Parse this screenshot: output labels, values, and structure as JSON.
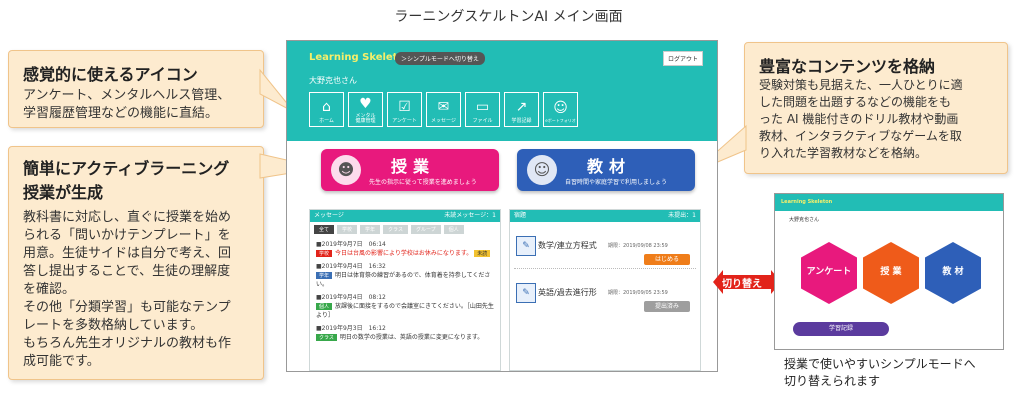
{
  "caption_top": "ラーニングスケルトンAI メイン画面",
  "callouts": {
    "icons": {
      "title": "感覚的に使えるアイコン",
      "body": "アンケート、メンタルヘルス管理、\n学習履歴管理などの機能に直結。"
    },
    "active": {
      "title": "簡単にアクティブラーニング\n授業が生成",
      "body": "教科書に対応し、直ぐに授業を始め\nられる「問いかけテンプレート」を\n用意。生徒サイドは自分で考え、回\n答し提出することで、生徒の理解度\nを確認。\nその他「分類学習」も可能なテンプ\nレートを多数格納しています。\nもちろん先生オリジナルの教材も作\n成可能です。"
    },
    "contents": {
      "title": "豊富なコンテンツを格納",
      "body": "受験対策も見据えた、一人ひとりに適\nした問題を出題するなどの機能をも\nった AI 機能付きのドリル教材や動画\n教材、インタラクティブなゲームを取\nり入れた学習教材などを格納。"
    }
  },
  "screen": {
    "logo": "Learning Skeleton",
    "mode_button": "＞シンプルモードへ切り替え",
    "logout": "ログアウト",
    "user_name": "大野克也さん",
    "icons": [
      {
        "label": "ホーム",
        "icon": "home-icon",
        "glyph": "⌂"
      },
      {
        "label": "メンタル\n健康管理",
        "icon": "heart-icon",
        "glyph": "♥"
      },
      {
        "label": "アンケート",
        "icon": "survey-icon",
        "glyph": "☑"
      },
      {
        "label": "メッセージ",
        "icon": "chat-icon",
        "glyph": "💬"
      },
      {
        "label": "ファイル",
        "icon": "folder-icon",
        "glyph": "▭"
      },
      {
        "label": "学習記録",
        "icon": "chart-icon",
        "glyph": "↗"
      },
      {
        "label": "eポートフォリオ",
        "icon": "portfolio-icon",
        "glyph": "☺"
      }
    ],
    "lesson": {
      "title": "授業",
      "sub": "先生の指示に従って授業を進めましょう"
    },
    "material": {
      "title": "教材",
      "sub": "自習時間や家庭学習で利用しましょう"
    },
    "messages": {
      "header": "メッセージ",
      "unread": "未読メッセージ：1",
      "tabs": [
        "全て",
        "学校",
        "学年",
        "クラス",
        "グループ",
        "個人"
      ],
      "items": [
        {
          "date": "■2019年9月7日　06:14",
          "tag": "学校",
          "tag_color": "#e2231a",
          "text": "今日は台風の影響により学校はお休みになります。",
          "badge": "未読",
          "red": true
        },
        {
          "date": "■2019年9月4日　16:32",
          "tag": "学年",
          "tag_color": "#3b6fb4",
          "text": "明日は体育祭の練習があるので、体育着を持参してください。",
          "badge": "",
          "red": false
        },
        {
          "date": "■2019年9月4日　08:12",
          "tag": "個人",
          "tag_color": "#38a84b",
          "text": "放課後に面接をするので会議室にきてください。［山田先生より］",
          "badge": "",
          "red": false
        },
        {
          "date": "■2019年9月3日　16:12",
          "tag": "クラス",
          "tag_color": "#38a84b",
          "text": "明日の数学の授業は、英語の授業に変更になります。",
          "badge": "",
          "red": false
        }
      ]
    },
    "homework": {
      "header": "宿題",
      "unsubmitted": "未提出：1",
      "items": [
        {
          "title": "数学/連立方程式",
          "deadline": "期限：2019/09/08 23:59",
          "button": "はじめる",
          "button_color": "#ef7d1a"
        },
        {
          "title": "英語/過去進行形",
          "deadline": "期限：2019/09/05 23:59",
          "button": "提出済み",
          "button_color": "#9e9e9e"
        }
      ]
    }
  },
  "switch_label": "切り替え",
  "simple": {
    "logo": "Learning Skeleton",
    "user_name": "大野克也さん",
    "hexes": [
      {
        "title": "アンケート",
        "color": "#e8197d"
      },
      {
        "title": "授 業",
        "color": "#ef5b1a"
      },
      {
        "title": "教 材",
        "color": "#2e5fb8"
      }
    ],
    "record_button": "学習記録",
    "caption": "授業で使いやすいシンプルモードへ\n切り替えられます"
  }
}
